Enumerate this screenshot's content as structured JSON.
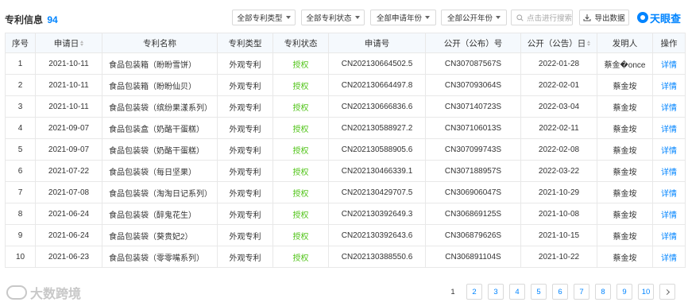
{
  "header": {
    "title": "专利信息",
    "count": "94",
    "filters": [
      "全部专利类型",
      "全部专利状态",
      "全部申请年份",
      "全部公开年份"
    ],
    "search_placeholder": "点击进行搜索",
    "export_label": "导出数据",
    "brand": "天眼查"
  },
  "table": {
    "columns": [
      "序号",
      "申请日",
      "专利名称",
      "专利类型",
      "专利状态",
      "申请号",
      "公开（公布）号",
      "公开（公告）日",
      "发明人",
      "操作"
    ],
    "rows": [
      {
        "no": "1",
        "apply_date": "2021-10-11",
        "name": "食品包装箱（盼盼雪饼）",
        "type": "外观专利",
        "status": "授权",
        "apply_no": "CN202130664502.5",
        "pub_no": "CN307087567S",
        "pub_date": "2022-01-28",
        "inventor": "蔡金�once",
        "action": "详情"
      },
      {
        "no": "2",
        "apply_date": "2021-10-11",
        "name": "食品包装箱（盼盼仙贝）",
        "type": "外观专利",
        "status": "授权",
        "apply_no": "CN202130664497.8",
        "pub_no": "CN307093064S",
        "pub_date": "2022-02-01",
        "inventor": "蔡金垵",
        "action": "详情"
      },
      {
        "no": "3",
        "apply_date": "2021-10-11",
        "name": "食品包装袋（缤纷果漾系列）",
        "type": "外观专利",
        "status": "授权",
        "apply_no": "CN202130666836.6",
        "pub_no": "CN307140723S",
        "pub_date": "2022-03-04",
        "inventor": "蔡金垵",
        "action": "详情"
      },
      {
        "no": "4",
        "apply_date": "2021-09-07",
        "name": "食品包装盒（奶酪干蛋糕）",
        "type": "外观专利",
        "status": "授权",
        "apply_no": "CN202130588927.2",
        "pub_no": "CN307106013S",
        "pub_date": "2022-02-11",
        "inventor": "蔡金垵",
        "action": "详情"
      },
      {
        "no": "5",
        "apply_date": "2021-09-07",
        "name": "食品包装袋（奶酪干蛋糕）",
        "type": "外观专利",
        "status": "授权",
        "apply_no": "CN202130588905.6",
        "pub_no": "CN307099743S",
        "pub_date": "2022-02-08",
        "inventor": "蔡金垵",
        "action": "详情"
      },
      {
        "no": "6",
        "apply_date": "2021-07-22",
        "name": "食品包装袋（每日坚果）",
        "type": "外观专利",
        "status": "授权",
        "apply_no": "CN202130466339.1",
        "pub_no": "CN307188957S",
        "pub_date": "2022-03-22",
        "inventor": "蔡金垵",
        "action": "详情"
      },
      {
        "no": "7",
        "apply_date": "2021-07-08",
        "name": "食品包装袋（淘淘日记系列）",
        "type": "外观专利",
        "status": "授权",
        "apply_no": "CN202130429707.5",
        "pub_no": "CN306906047S",
        "pub_date": "2021-10-29",
        "inventor": "蔡金垵",
        "action": "详情"
      },
      {
        "no": "8",
        "apply_date": "2021-06-24",
        "name": "食品包装袋（醉鬼花生）",
        "type": "外观专利",
        "status": "授权",
        "apply_no": "CN202130392649.3",
        "pub_no": "CN306869125S",
        "pub_date": "2021-10-08",
        "inventor": "蔡金垵",
        "action": "详情"
      },
      {
        "no": "9",
        "apply_date": "2021-06-24",
        "name": "食品包装袋（葵贵妃2）",
        "type": "外观专利",
        "status": "授权",
        "apply_no": "CN202130392643.6",
        "pub_no": "CN306879626S",
        "pub_date": "2021-10-15",
        "inventor": "蔡金垵",
        "action": "详情"
      },
      {
        "no": "10",
        "apply_date": "2021-06-23",
        "name": "食品包装袋（零零嘴系列）",
        "type": "外观专利",
        "status": "授权",
        "apply_no": "CN202130388550.6",
        "pub_no": "CN306891104S",
        "pub_date": "2021-10-22",
        "inventor": "蔡金垵",
        "action": "详情"
      }
    ]
  },
  "pagination": {
    "pages": [
      "1",
      "2",
      "3",
      "4",
      "5",
      "6",
      "7",
      "8",
      "9",
      "10"
    ],
    "current": "1"
  },
  "watermark": "大数跨境",
  "colors": {
    "accent": "#0084ff",
    "granted": "#52c41a",
    "header_bg": "#f5f9fd"
  }
}
